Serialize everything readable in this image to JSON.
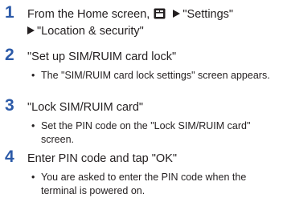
{
  "steps": [
    {
      "number": "1",
      "line1_prefix": "From the Home screen,",
      "menu_icon": "menu-key-icon",
      "line1_item": "\"Settings\"",
      "line2_item": "\"Location & security\""
    },
    {
      "number": "2",
      "text": "\"Set up SIM/RUIM card lock\"",
      "bullet": "The \"SIM/RUIM card lock settings\" screen appears."
    },
    {
      "number": "3",
      "text": "\"Lock SIM/RUIM card\"",
      "bullet": "Set the PIN code on the \"Lock SIM/RUIM card\" screen."
    },
    {
      "number": "4",
      "text": "Enter PIN code and tap \"OK\"",
      "bullet": "You are asked to enter the PIN code when the terminal is powered on."
    }
  ],
  "bullet_symbol": "•",
  "colors": {
    "step_number": "#2c5aa8",
    "text": "#231f20"
  }
}
